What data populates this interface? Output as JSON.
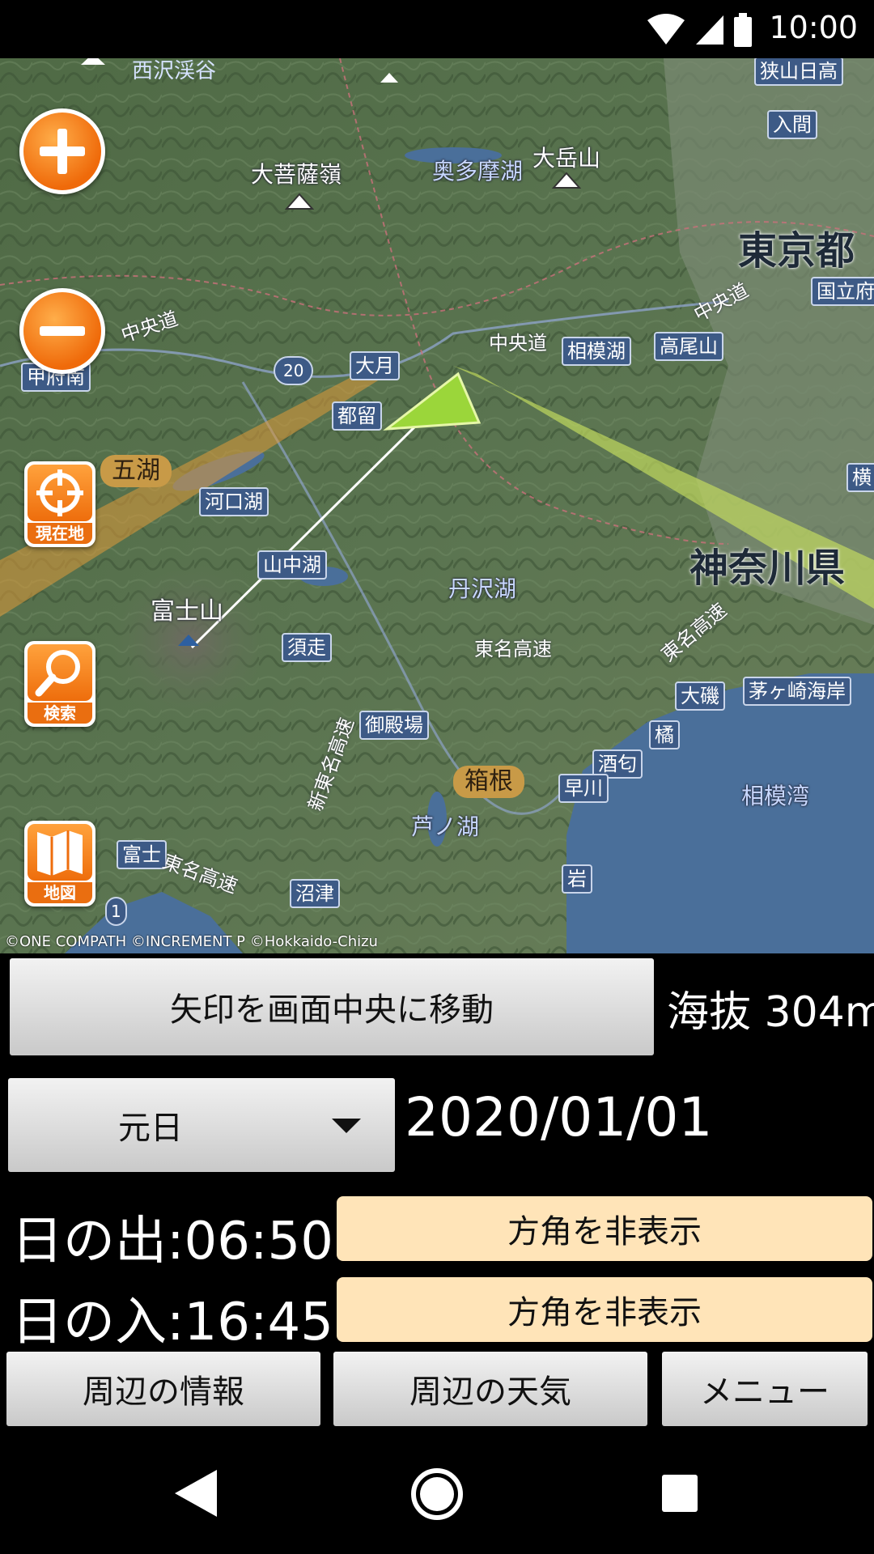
{
  "status_bar": {
    "time": "10:00",
    "icons": [
      "wifi-icon",
      "signal-icon",
      "battery-icon"
    ]
  },
  "map": {
    "labels": {
      "nishizawa": "西沢渓谷",
      "sayama": "狭山日高",
      "iruma": "入間",
      "daibosatsu": "大菩薩嶺",
      "okutama": "奥多摩湖",
      "daigaku": "大岳山",
      "tokyo": "東京都",
      "chuo_road_w": "中央道",
      "chuo_road_e": "中央道",
      "chuo_road_ne": "中央道",
      "kokuritsu": "国立府",
      "kofu": "甲府南",
      "sagamiko": "相模湖",
      "takaosan": "高尾山",
      "route20": "20",
      "otsuki": "大月",
      "tsuru": "都留",
      "fujigoko": "五湖",
      "kawaguchiko": "河口湖",
      "yamanakako": "山中湖",
      "kanagawa": "神奈川県",
      "tanzawako": "丹沢湖",
      "fujisan": "富士山",
      "subashiri": "須走",
      "tomei_n": "東名高速",
      "tomei_e": "東名高速",
      "chigasaki": "茅ヶ崎海岸",
      "oiso": "大磯",
      "gotemba": "御殿場",
      "tachibana": "橘",
      "sakawa": "酒匂",
      "hakone": "箱根",
      "hayakawa": "早川",
      "sagamiwan": "相模湾",
      "shintomei": "新東名高速",
      "ashinoko": "芦ノ湖",
      "fuji": "富士",
      "tomei_sw": "東名高速",
      "numazu": "沼津",
      "iwa": "岩",
      "route1": "1",
      "yoko": "横"
    },
    "copyright": "©ONE COMPATH ©INCREMENT P ©Hokkaido-Chizu",
    "buttons": {
      "current_location": "現在地",
      "search": "検索",
      "map": "地図"
    }
  },
  "controls": {
    "center_arrow_label": "矢印を画面中央に移動",
    "altitude": "海抜 304m",
    "date_select": "元日",
    "date": "2020/01/01",
    "sunrise": "日の出:06:50",
    "sunset": "日の入:16:45",
    "hide_sunrise_direction": "方角を非表示",
    "hide_sunset_direction": "方角を非表示",
    "nearby_info": "周辺の情報",
    "nearby_weather": "周辺の天気",
    "menu": "メニュー"
  },
  "colors": {
    "accent": "#ef6a0a",
    "peach_button": "#ffe4b8",
    "sea": "#4a6f9a"
  }
}
